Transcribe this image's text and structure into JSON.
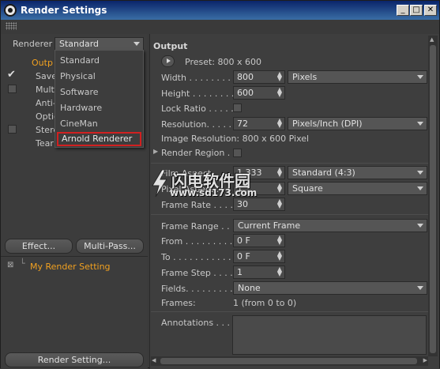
{
  "window": {
    "title": "Render Settings"
  },
  "left": {
    "renderer_label": "Renderer",
    "renderer_value": "Standard",
    "renderer_menu": [
      "Standard",
      "Physical",
      "Software",
      "Hardware",
      "CineMan",
      "Arnold Renderer"
    ],
    "tree_items": [
      "Outp",
      "Save",
      "Multi",
      "Anti-",
      "Optic",
      "Stere",
      "Tear"
    ],
    "effect_button": "Effect...",
    "multipass_button": "Multi-Pass...",
    "render_setting_name": "My Render Setting",
    "render_setting_button": "Render Setting..."
  },
  "output": {
    "header": "Output",
    "preset": "Preset: 800 x 600",
    "width_label": "Width . . . . . . . . .",
    "width_value": "800",
    "width_unit": "Pixels",
    "height_label": "Height . . . . . . . .",
    "height_value": "600",
    "lock_ratio_label": "Lock Ratio . . . . . .",
    "resolution_label": "Resolution. . . . . .",
    "resolution_value": "72",
    "resolution_unit": "Pixels/Inch (DPI)",
    "image_resolution": "Image Resolution: 800 x 600 Pixel",
    "render_region_label": "Render Region . .",
    "film_aspect_label": "Film Aspect . . . . .",
    "film_aspect_value": "1.333",
    "film_aspect_preset": "Standard (4:3)",
    "pixel_aspect_label": "Pixel Aspect . . . .",
    "pixel_aspect_value": "1",
    "pixel_aspect_preset": "Square",
    "frame_rate_label": "Frame Rate . . . . .",
    "frame_rate_value": "30",
    "frame_range_label": "Frame Range . . .",
    "frame_range_value": "Current Frame",
    "from_label": "From . . . . . . . . . . .",
    "from_value": "0 F",
    "to_label": "To . . . . . . . . . . . . .",
    "to_value": "0 F",
    "frame_step_label": "Frame Step . . . . .",
    "frame_step_value": "1",
    "fields_label": "Fields. . . . . . . . . .",
    "fields_value": "None",
    "frames_label": "Frames:",
    "frames_value": "1 (from 0 to 0)",
    "annotations_label": "Annotations . . . ."
  },
  "watermark": {
    "text1": "闪电软件园",
    "text2": "www.sd173.com"
  },
  "colors": {
    "accent_orange": "#f0a020",
    "highlight_border": "#d12020"
  },
  "icons": [
    "app-icon",
    "minimize-icon",
    "maximize-icon",
    "close-icon",
    "play-icon",
    "checkmark-icon"
  ]
}
